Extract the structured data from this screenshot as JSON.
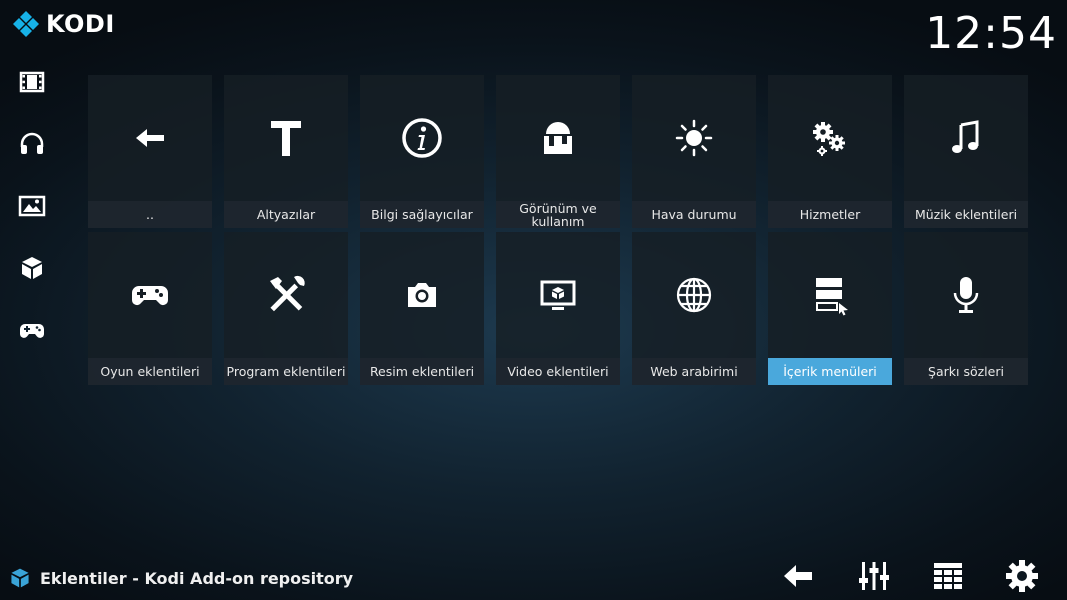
{
  "app": {
    "logo_text": "KODI",
    "clock": "12:54"
  },
  "sidebar": {
    "items": [
      {
        "name": "movies",
        "icon": "film-icon"
      },
      {
        "name": "music",
        "icon": "headphones-icon"
      },
      {
        "name": "pictures",
        "icon": "picture-icon"
      },
      {
        "name": "addons",
        "icon": "box-icon"
      },
      {
        "name": "games",
        "icon": "gamepad-icon"
      }
    ]
  },
  "tiles": [
    {
      "label": "..",
      "icon": "arrow-left-icon"
    },
    {
      "label": "Altyazılar",
      "icon": "letter-t-icon"
    },
    {
      "label": "Bilgi sağlayıcılar",
      "icon": "info-icon"
    },
    {
      "label": "Görünüm ve kullanım",
      "icon": "paint-bucket-icon"
    },
    {
      "label": "Hava durumu",
      "icon": "sun-icon"
    },
    {
      "label": "Hizmetler",
      "icon": "gears-icon"
    },
    {
      "label": "Müzik eklentileri",
      "icon": "music-note-icon"
    },
    {
      "label": "Oyun eklentileri",
      "icon": "gamepad-icon"
    },
    {
      "label": "Program eklentileri",
      "icon": "tools-icon"
    },
    {
      "label": "Resim eklentileri",
      "icon": "camera-icon"
    },
    {
      "label": "Video eklentileri",
      "icon": "monitor-icon"
    },
    {
      "label": "Web arabirimi",
      "icon": "globe-icon"
    },
    {
      "label": "İçerik menüleri",
      "icon": "context-menu-icon"
    },
    {
      "label": "Şarkı sözleri",
      "icon": "microphone-icon"
    }
  ],
  "focused_tile": "İçerik menüleri",
  "footer": {
    "title": "Eklentiler - Kodi Add-on repository",
    "buttons": [
      "back-arrow-icon",
      "sliders-icon",
      "grid-view-icon",
      "settings-gear-icon"
    ]
  },
  "colors": {
    "accent": "#4aa8dc",
    "kodi_blue": "#17b2e8",
    "tile_bg": "#161e25"
  }
}
